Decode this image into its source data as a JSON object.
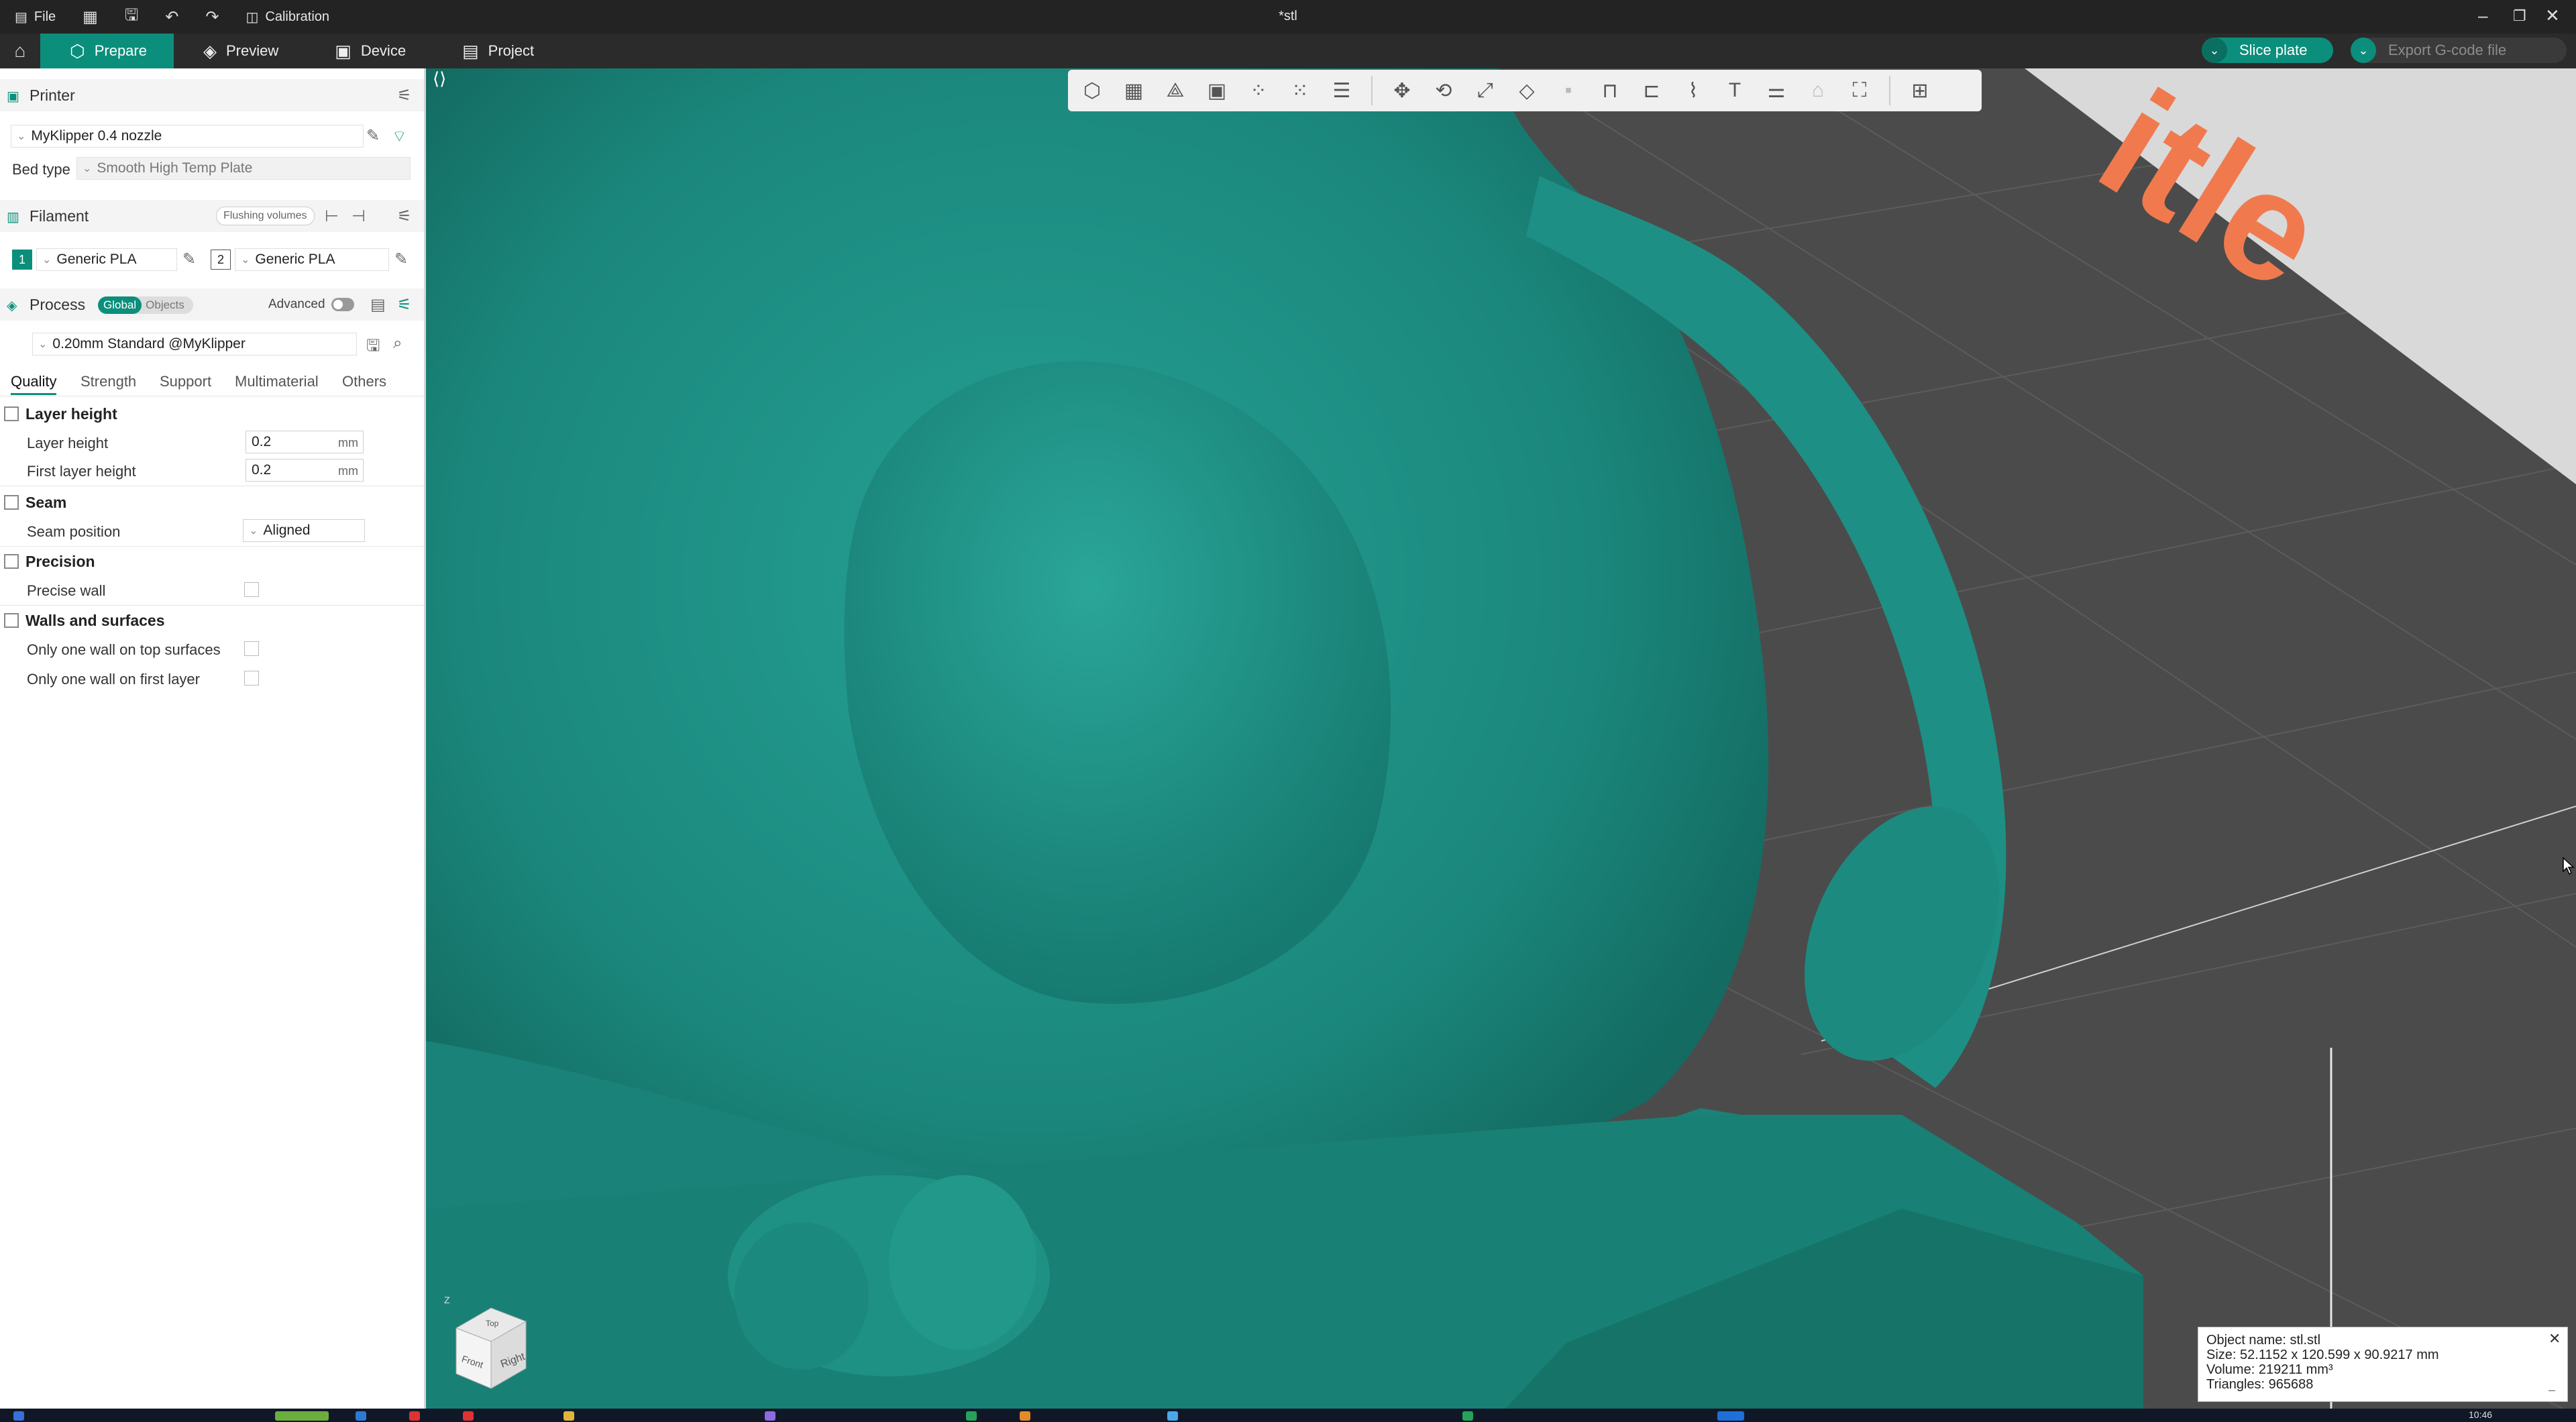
{
  "window": {
    "title": "*stl",
    "file_label": "File",
    "calibration_label": "Calibration"
  },
  "tabs": [
    {
      "label": "Prepare",
      "icon": "cube-icon"
    },
    {
      "label": "Preview",
      "icon": "layers-icon"
    },
    {
      "label": "Device",
      "icon": "device-icon"
    },
    {
      "label": "Project",
      "icon": "project-icon"
    }
  ],
  "actions": {
    "slice_label": "Slice plate",
    "export_label": "Export G-code file"
  },
  "printer": {
    "section_title": "Printer",
    "name": "MyKlipper 0.4 nozzle",
    "bed_type_label": "Bed type",
    "bed_type_value": "Smooth High Temp Plate"
  },
  "filament": {
    "section_title": "Filament",
    "flushing_label": "Flushing volumes",
    "slots": [
      {
        "index": "1",
        "name": "Generic PLA",
        "color": "#0b8f7c"
      },
      {
        "index": "2",
        "name": "Generic PLA",
        "color": "#ffffff"
      }
    ]
  },
  "process": {
    "section_title": "Process",
    "toggle_global": "Global",
    "toggle_objects": "Objects",
    "advanced_label": "Advanced",
    "preset": "0.20mm Standard @MyKlipper",
    "tabs": [
      "Quality",
      "Strength",
      "Support",
      "Multimaterial",
      "Others"
    ]
  },
  "quality": {
    "layer_height_group": "Layer height",
    "layer_height_label": "Layer height",
    "layer_height_value": "0.2",
    "first_layer_height_label": "First layer height",
    "first_layer_height_value": "0.2",
    "unit": "mm",
    "seam_group": "Seam",
    "seam_position_label": "Seam position",
    "seam_position_value": "Aligned",
    "precision_group": "Precision",
    "precise_wall_label": "Precise wall",
    "walls_group": "Walls and surfaces",
    "one_wall_top_label": "Only one wall on top surfaces",
    "one_wall_first_label": "Only one wall on first layer"
  },
  "object_info": {
    "name": "Object name: stl.stl",
    "size": "Size: 52.1152 x 120.599 x 90.9217 mm",
    "volume": "Volume: 219211 mm³",
    "triangles": "Triangles: 965688"
  },
  "nav_cube": {
    "front": "Front",
    "right": "Right",
    "top": "Top",
    "axis_z": "Z"
  },
  "taskbar": {
    "clock": "10:46"
  },
  "colors": {
    "accent": "#0b8f7c",
    "model": "#1f8f84",
    "bed": "#4a4a4a",
    "logo_text": "#f07a4e"
  }
}
